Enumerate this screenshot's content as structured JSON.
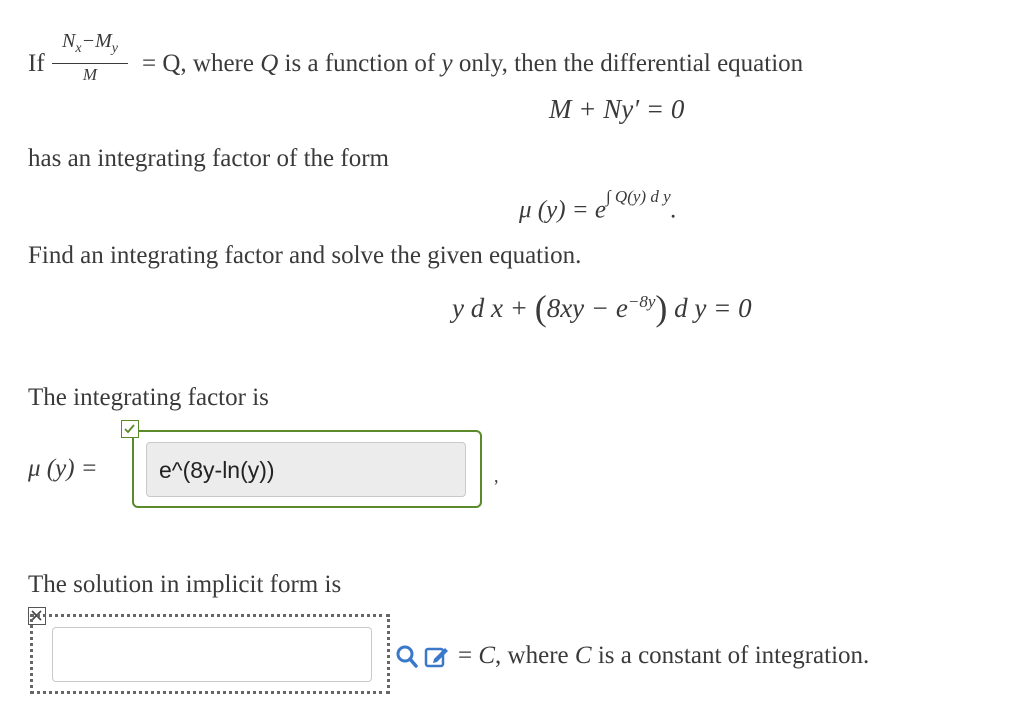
{
  "problem": {
    "if_label": "If",
    "frac_num": "N",
    "frac_num_sub1": "x",
    "frac_minus": "−M",
    "frac_num_sub2": "y",
    "frac_den": "M",
    "cond_eq": "= Q,",
    "cond_where": " where ",
    "cond_q": "Q",
    "cond_mid": " is a function of ",
    "cond_y": "y",
    "cond_tail": " only, then the differential equation",
    "eq1": "M + Ny′ = 0",
    "has_if": "has an integrating factor of the form",
    "mu_lhs": "μ (y) = e",
    "mu_exp": "∫ Q(y) d y",
    "mu_dot": ".",
    "find": "Find an integrating factor and solve the given equation.",
    "eq2_a": "y d x + ",
    "eq2_b": "8xy − e",
    "eq2_exp": "−8y",
    "eq2_c": " d y = 0"
  },
  "integrating": {
    "label": "The integrating factor is",
    "mu": "μ (y) =",
    "answer": "e^(8y-ln(y))",
    "comma": ","
  },
  "solution": {
    "label": "The solution in implicit form is",
    "tail_eq": "= ",
    "tail_c": "C",
    "tail_where": ", where ",
    "tail_c2": "C",
    "tail_rest": " is a constant of integration."
  },
  "colors": {
    "correct": "#5a8a2a",
    "icon_blue": "#3a78c9"
  }
}
